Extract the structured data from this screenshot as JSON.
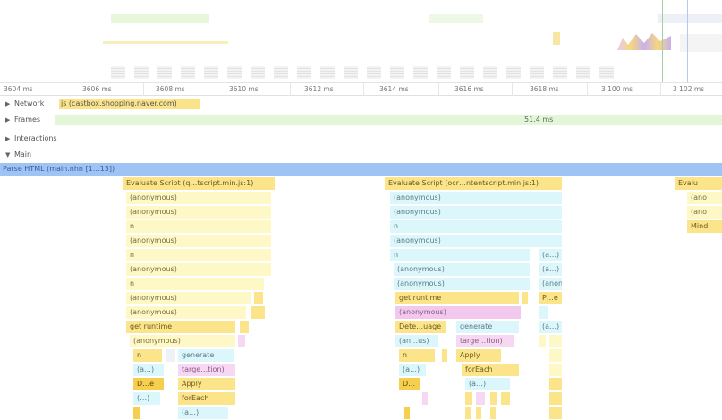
{
  "ruler": {
    "ticks": [
      "3604 ms",
      "3606 ms",
      "3608 ms",
      "3610 ms",
      "3612 ms",
      "3614 ms",
      "3616 ms",
      "3618 ms",
      "3 100 ms",
      "3 102 ms"
    ]
  },
  "tracks": {
    "network": {
      "label": "Network",
      "request": "js (castbox.shopping.naver.com)"
    },
    "frames": {
      "label": "Frames",
      "duration": "51.4 ms"
    },
    "interactions": {
      "label": "Interactions"
    },
    "main": {
      "label": "Main"
    }
  },
  "main": {
    "parse": "Parse HTML (main.nhn [1…13])",
    "stack_a": {
      "evaluate": "Evaluate Script (q…tscript.min.js:1)",
      "anon1": "(anonymous)",
      "anon2": "(anonymous)",
      "n1": "n",
      "anon3": "(anonymous)",
      "n2": "n",
      "anon4": "(anonymous)",
      "n3": "n",
      "anon5": "(anonymous)",
      "anon6": "(anonymous)",
      "get_runtime": "get runtime",
      "anon7": "(anonymous)",
      "n4": "n",
      "generate": "generate",
      "a1": "(a…)",
      "target": "targe…tion)",
      "de": "D…e",
      "apply": "Apply",
      "paren": "(…)",
      "foreach": "forEach",
      "a2": "(a…)"
    },
    "stack_b": {
      "evaluate": "Evaluate Script (ocr…ntentscript.min.js:1)",
      "anon1": "(anonymous)",
      "anon2": "(anonymous)",
      "n1": "n",
      "anon3": "(anonymous)",
      "n2": "n",
      "side1": "(a…)",
      "anon4": "(anonymous)",
      "side2": "(a…)",
      "anon5": "(anonymous)",
      "side3": "(anon",
      "get_runtime": "get runtime",
      "side4": "P…e",
      "anon6": "(anonymous)",
      "dete": "Dete…uage",
      "generate": "generate",
      "side5": "(a…)",
      "anus": "(an…us)",
      "target": "targe…tion)",
      "n3": "n",
      "apply": "Apply",
      "a1": "(a…)",
      "foreach": "forEach",
      "d": "D…",
      "a2": "(a…)"
    },
    "stack_c": {
      "evaluate": "Evalu",
      "anon1": "(ano",
      "anon2": "(ano",
      "mind": "Mind"
    }
  },
  "colors": {
    "scripting_light": "#fdf8c6",
    "scripting": "#fce48b",
    "scripting_dark": "#f7cf4e",
    "parse": "#9ec3f5",
    "cyan": "#dcf7fb",
    "pink": "#f7d8f2"
  }
}
